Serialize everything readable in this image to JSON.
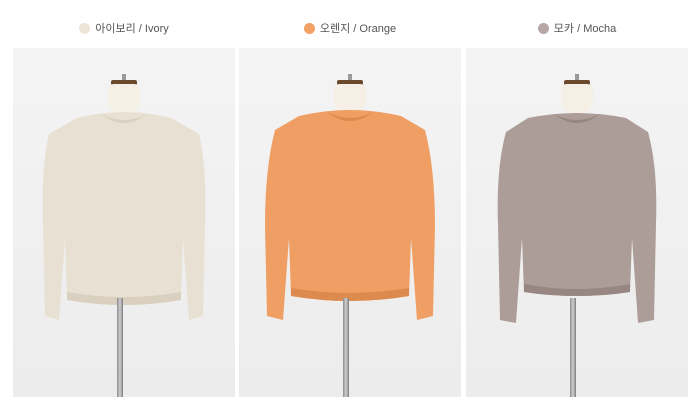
{
  "products": [
    {
      "label": "아이보리 / Ivory",
      "dot_color": "#ece5d8",
      "sweater_color": "#e8e1d3",
      "sweater_shade": "#d9d0bf"
    },
    {
      "label": "오렌지 / Orange",
      "dot_color": "#f2a064",
      "sweater_color": "#ef9f63",
      "sweater_shade": "#dc8a4e"
    },
    {
      "label": "모카 / Mocha",
      "dot_color": "#b7a6a6",
      "sweater_color": "#ad9d98",
      "sweater_shade": "#978681"
    }
  ]
}
